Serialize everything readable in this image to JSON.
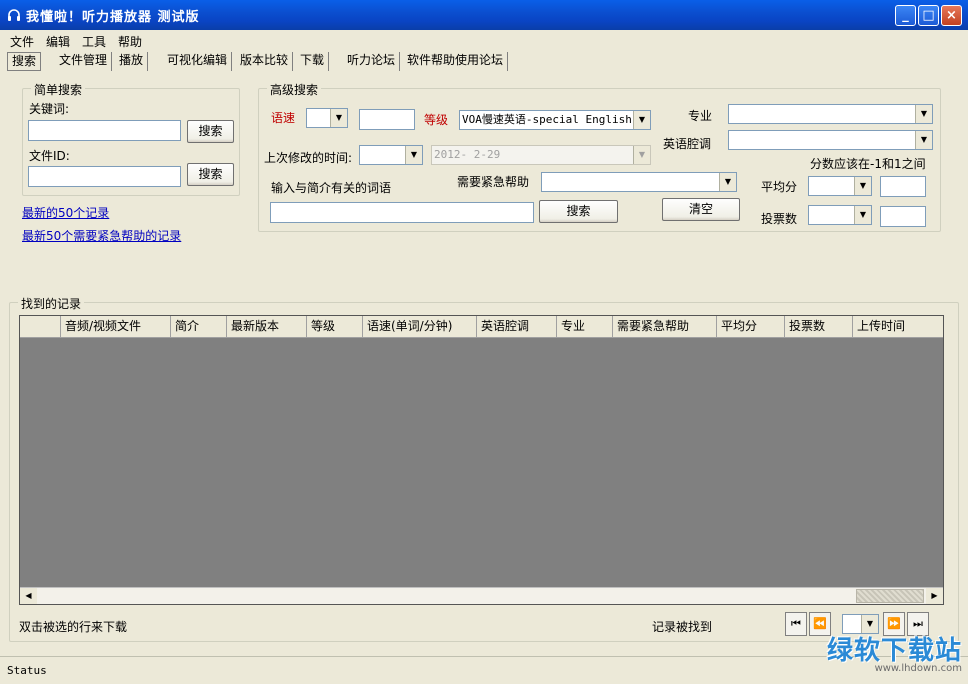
{
  "window": {
    "title": "我懂啦！听力播放器 测试版",
    "buttons": {
      "minimize": "_",
      "maximize": "□",
      "close": "×"
    }
  },
  "menu": [
    "文件",
    "编辑",
    "工具",
    "帮助"
  ],
  "tabs": [
    "搜索",
    "文件管理",
    "播放",
    "可视化编辑",
    "版本比较",
    "下载",
    "听力论坛",
    "软件帮助使用论坛"
  ],
  "simple_search": {
    "title": "简单搜索",
    "keyword_label": "关键词:",
    "keyword_value": "",
    "search_button": "搜索",
    "file_id_label": "文件ID:",
    "file_id_value": "",
    "search_button_2": "搜索"
  },
  "links": {
    "latest_50": "最新的50个记录",
    "latest_50_urgent": "最新50个需要紧急帮助的记录"
  },
  "advanced_search": {
    "title": "高级搜索",
    "speed_label": "语速",
    "speed_value": "",
    "speed_text": "",
    "level_label": "等级",
    "level_value": "VOA慢速英语-special English",
    "major_label": "专业",
    "major_value": "",
    "accent_label": "英语腔调",
    "accent_value": "",
    "last_modified_label": "上次修改的时间:",
    "last_modified_op": "",
    "last_modified_date": "2012- 2-29",
    "score_hint": "分数应该在-1和1之间",
    "keywords_label": "输入与简介有关的词语",
    "keywords_value": "",
    "urgent_label": "需要紧急帮助",
    "urgent_value": "",
    "avg_score_label": "平均分",
    "avg_score_op": "",
    "avg_score_value": "",
    "votes_label": "投票数",
    "votes_op": "",
    "votes_value": "",
    "search_button": "搜索",
    "clear_button": "清空"
  },
  "results": {
    "title": "找到的记录",
    "columns": [
      "",
      "音频/视频文件",
      "简介",
      "最新版本",
      "等级",
      "语速(单词/分钟)",
      "英语腔调",
      "专业",
      "需要紧急帮助",
      "平均分",
      "投票数",
      "上传时间"
    ],
    "rows": []
  },
  "footer": {
    "hint": "双击被选的行来下载",
    "found_label": "记录被找到",
    "page_value": "",
    "nav": {
      "first": "⏮",
      "prev": "⏪",
      "next": "⏩",
      "last": "⏭"
    }
  },
  "status": "Status",
  "watermark": {
    "logo": "绿软下载站",
    "url": "www.lhdown.com"
  }
}
